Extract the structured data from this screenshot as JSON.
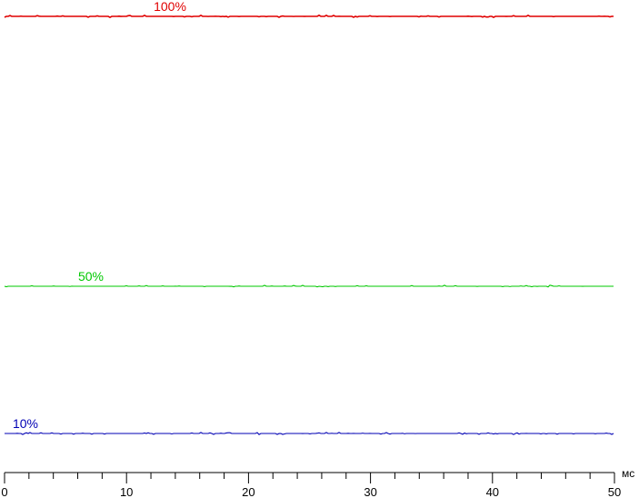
{
  "chart_data": {
    "type": "line",
    "x": [
      0,
      50
    ],
    "xlim": [
      0,
      50
    ],
    "ylim": [
      0,
      100
    ],
    "xlabel": "мс",
    "x_ticks": [
      "0",
      "10",
      "20",
      "30",
      "40",
      "50"
    ],
    "grid": false,
    "legend": "inline labels above each line",
    "series": [
      {
        "name": "100%",
        "color": "#e00000",
        "values": [
          100,
          100
        ]
      },
      {
        "name": "50%",
        "color": "#00c800",
        "values": [
          50,
          50
        ]
      },
      {
        "name": "10%",
        "color": "#0000b4",
        "values": [
          10,
          10
        ]
      }
    ]
  }
}
